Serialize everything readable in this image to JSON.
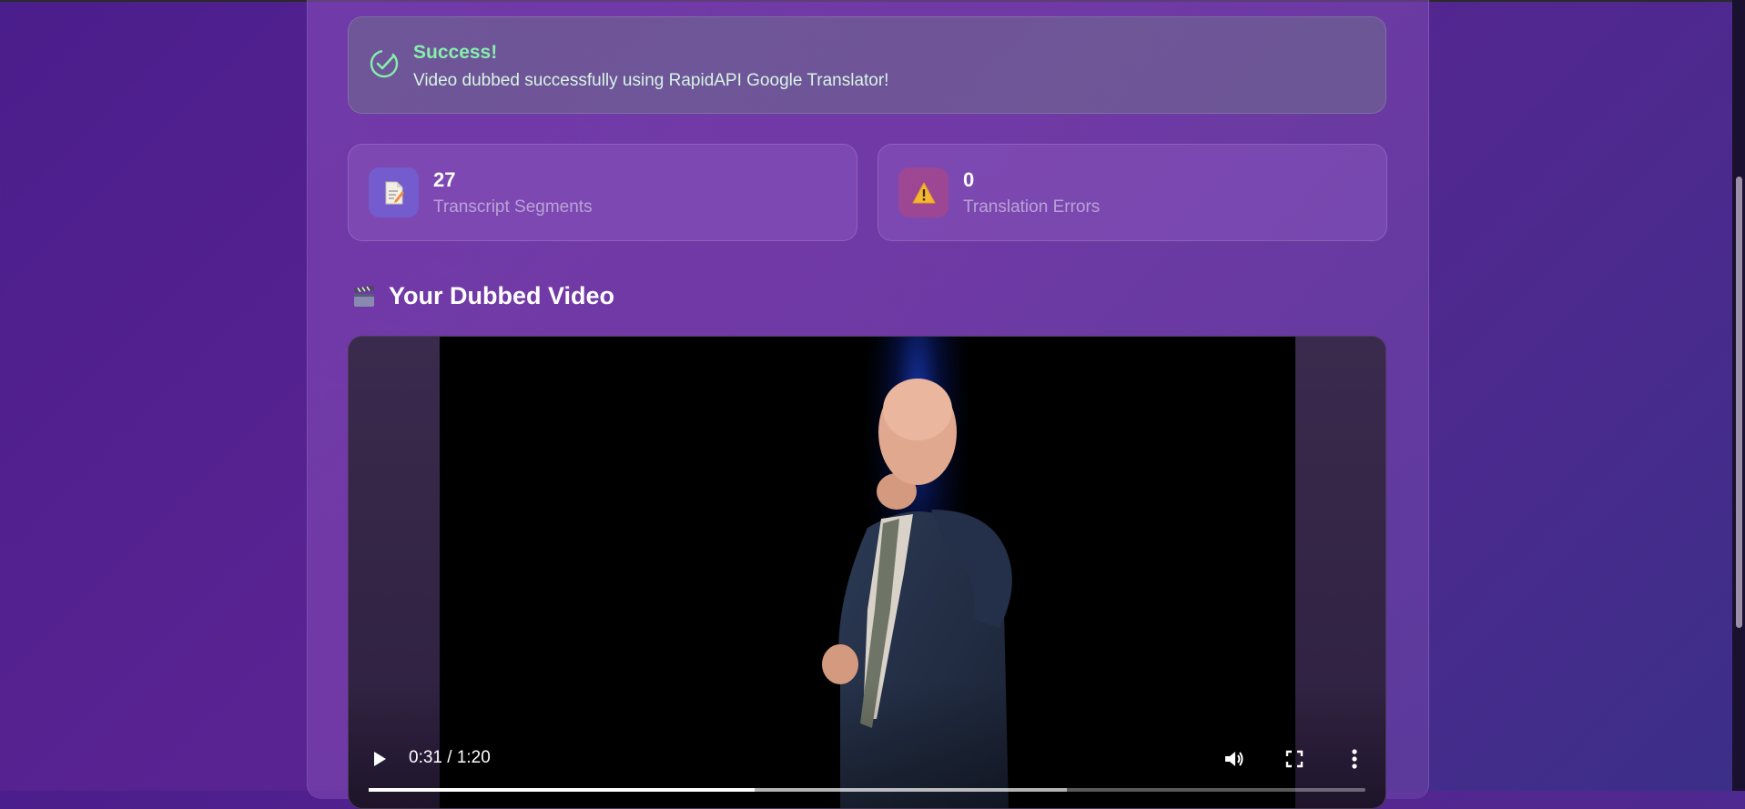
{
  "alert": {
    "title": "Success!",
    "message": "Video dubbed successfully using RapidAPI Google Translator!",
    "color": "#86efac"
  },
  "stats": [
    {
      "value": "27",
      "label": "Transcript Segments",
      "icon": "document-icon"
    },
    {
      "value": "0",
      "label": "Translation Errors",
      "icon": "warning-icon"
    }
  ],
  "section": {
    "icon": "clapperboard-icon",
    "title": "Your Dubbed Video"
  },
  "video": {
    "time_display": "0:31 / 1:20",
    "progress_fraction": 0.3875,
    "controls": [
      "play-icon",
      "volume-icon",
      "fullscreen-icon",
      "more-options-icon"
    ]
  }
}
